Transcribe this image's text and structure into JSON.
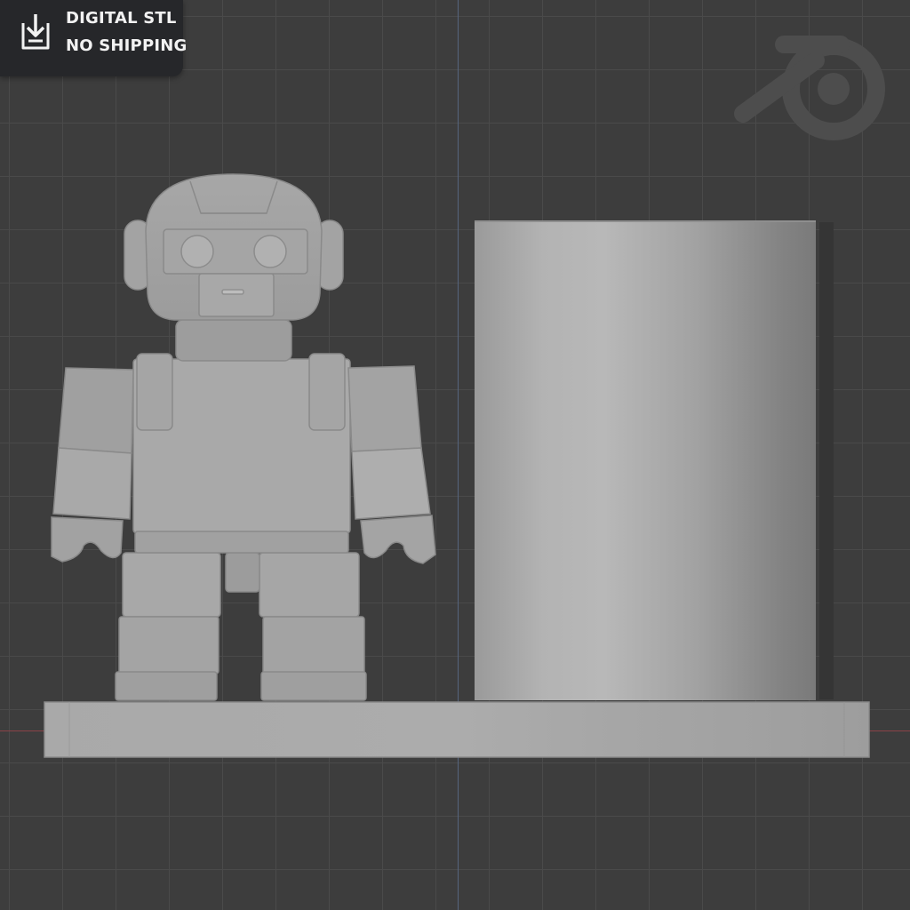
{
  "badge": {
    "line1": "DIGITAL STL",
    "line2": "NO SHIPPING",
    "icon": "download-icon"
  },
  "viewport": {
    "background_color": "#3d3d3d",
    "grid_color": "#4a4a4a",
    "y_axis_color": "#56657e",
    "x_axis_color": "#8a4248",
    "watermark": "blender-logo-icon"
  },
  "model": {
    "objects": [
      "robot-figure",
      "cylinder-cup",
      "base-plate"
    ],
    "material_color": "#a8a8a8"
  }
}
